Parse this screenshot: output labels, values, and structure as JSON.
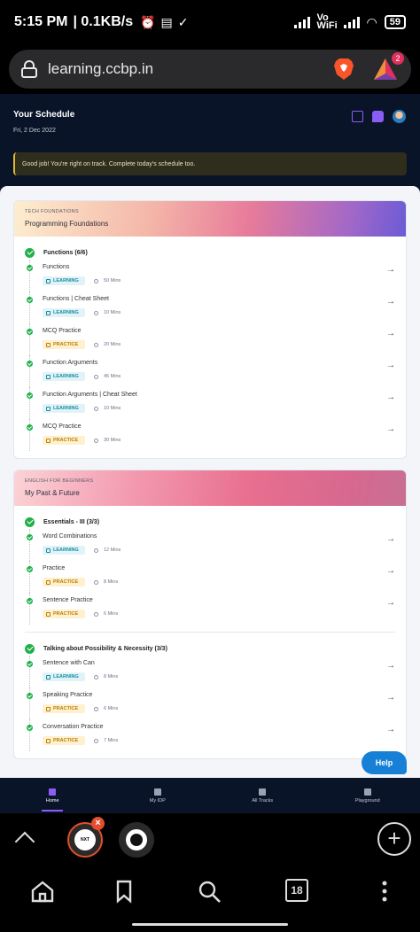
{
  "status_bar": {
    "time": "5:15 PM",
    "net_speed": "| 0.1KB/s",
    "network_label": "Vo WiFi",
    "battery": "59"
  },
  "browser": {
    "url": "learning.ccbp.in",
    "rewards_badge": "2",
    "tab_count": "18",
    "tab1_label": "NXT WAVE"
  },
  "schedule": {
    "title": "Your Schedule",
    "date": "Fri, 2 Dec 2022",
    "alert": "Good job! You're right on track. Complete today's schedule too."
  },
  "cards": [
    {
      "category": "TECH FOUNDATIONS",
      "title": "Programming Foundations",
      "sections": [
        {
          "title": "Functions (6/6)",
          "items": [
            {
              "title": "Functions",
              "tag": "LEARNING",
              "duration": "50 Mins"
            },
            {
              "title": "Functions | Cheat Sheet",
              "tag": "LEARNING",
              "duration": "10 Mins"
            },
            {
              "title": "MCQ Practice",
              "tag": "PRACTICE",
              "duration": "20 Mins"
            },
            {
              "title": "Function Arguments",
              "tag": "LEARNING",
              "duration": "45 Mins"
            },
            {
              "title": "Function Arguments | Cheat Sheet",
              "tag": "LEARNING",
              "duration": "10 Mins"
            },
            {
              "title": "MCQ Practice",
              "tag": "PRACTICE",
              "duration": "30 Mins"
            }
          ]
        }
      ]
    },
    {
      "category": "ENGLISH FOR BEGINNERS",
      "title": "My Past & Future",
      "sections": [
        {
          "title": "Essentials - III (3/3)",
          "items": [
            {
              "title": "Word Combinations",
              "tag": "LEARNING",
              "duration": "12 Mins"
            },
            {
              "title": "Practice",
              "tag": "PRACTICE",
              "duration": "8 Mins"
            },
            {
              "title": "Sentence Practice",
              "tag": "PRACTICE",
              "duration": "6 Mins"
            }
          ]
        },
        {
          "title": "Talking about Possibility & Necessity (3/3)",
          "items": [
            {
              "title": "Sentence with Can",
              "tag": "LEARNING",
              "duration": "8 Mins"
            },
            {
              "title": "Speaking Practice",
              "tag": "PRACTICE",
              "duration": "6 Mins"
            },
            {
              "title": "Conversation Practice",
              "tag": "PRACTICE",
              "duration": "7 Mins"
            }
          ]
        }
      ]
    }
  ],
  "help_label": "Help",
  "bottom_nav": [
    {
      "label": "Home",
      "icon": "home-icon",
      "active": true
    },
    {
      "label": "My IDP",
      "icon": "document-icon",
      "active": false
    },
    {
      "label": "All Tracks",
      "icon": "book-icon",
      "active": false
    },
    {
      "label": "Playground",
      "icon": "terminal-icon",
      "active": false
    }
  ],
  "colors": {
    "accent": "#8b5cf6",
    "success": "#21b04b",
    "help": "#1680d6"
  }
}
